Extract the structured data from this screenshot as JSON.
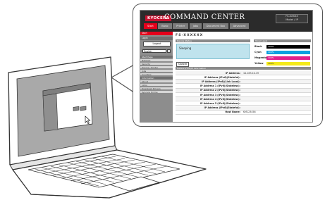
{
  "command_center": {
    "logo": "KYOCERA",
    "title": "COMMAND CENTER",
    "model_box": {
      "line1": "FS-XXXXX",
      "line2": "Model / IP"
    },
    "nav_tabs": [
      {
        "label": "Start",
        "active": true
      },
      {
        "label": "Basic",
        "active": false
      },
      {
        "label": "Printer",
        "active": false
      },
      {
        "label": "Jobs",
        "active": false
      },
      {
        "label": "Document Box",
        "active": false
      },
      {
        "label": "Advanced",
        "active": false
      }
    ],
    "sidebar": {
      "start": "Start",
      "login_heading": "Login",
      "login_button": "Logout",
      "language": "English",
      "items": [
        {
          "label": "Start Page",
          "highlight": true
        },
        {
          "label": "Network",
          "highlight": false
        },
        {
          "label": "Security",
          "highlight": false
        },
        {
          "label": "Device / Printer",
          "highlight": false
        },
        {
          "label": "Jobs",
          "highlight": false
        },
        {
          "label": "Counters",
          "highlight": false
        },
        {
          "label": "Information",
          "highlight": true
        },
        {
          "label": "About",
          "highlight": false
        },
        {
          "label": "Links",
          "highlight": false
        },
        {
          "label": "Download Drivers",
          "highlight": false
        },
        {
          "label": "Kyocera Online",
          "highlight": false
        }
      ]
    },
    "page_heading": "FS-XXXXXX",
    "device_status": {
      "heading": "Device Status",
      "message": "Sleeping",
      "cancel_label": "Cancel"
    },
    "toner": {
      "heading": "Toner Level",
      "items": [
        {
          "label": "Black",
          "percent": 100,
          "color": "#000000",
          "text_color": "#ffffff",
          "pct_text": "100%"
        },
        {
          "label": "Cyan",
          "percent": 100,
          "color": "#0aa0e0",
          "text_color": "#ffffff",
          "pct_text": "100%"
        },
        {
          "label": "Magenta",
          "percent": 100,
          "color": "#e0208c",
          "text_color": "#ffffff",
          "pct_text": "100%"
        },
        {
          "label": "Yellow",
          "percent": 100,
          "color": "#f4ea1a",
          "text_color": "#333333",
          "pct_text": "100%"
        }
      ]
    },
    "network": {
      "heading": "Network/TCP/IP Information",
      "rows": [
        {
          "label": "IP Address:",
          "value": "10.183.10.19"
        },
        {
          "label": "IP Address (IPv6)(Stateful):",
          "value": ""
        },
        {
          "label": "IP Address (IPv6)(Link Local):",
          "value": ""
        },
        {
          "label": "IP Address 1 (IPv6)(Stateless):",
          "value": ""
        },
        {
          "label": "IP Address 2 (IPv6)(Stateless):",
          "value": ""
        },
        {
          "label": "IP Address 3 (IPv6)(Stateless):",
          "value": ""
        },
        {
          "label": "IP Address 4 (IPv6)(Stateless):",
          "value": ""
        },
        {
          "label": "IP Address 5 (IPv6)(Stateless):",
          "value": ""
        },
        {
          "label": "IP Address (IPv6)(Stateful):",
          "value": ""
        },
        {
          "label": "Host Name:",
          "value": "KM123456"
        }
      ]
    }
  },
  "colors": {
    "accent_red": "#e4001b",
    "header_dark": "#2b2b2b",
    "sidebar_gray": "#8d8d8d",
    "status_blue": "#bfe3ed"
  }
}
